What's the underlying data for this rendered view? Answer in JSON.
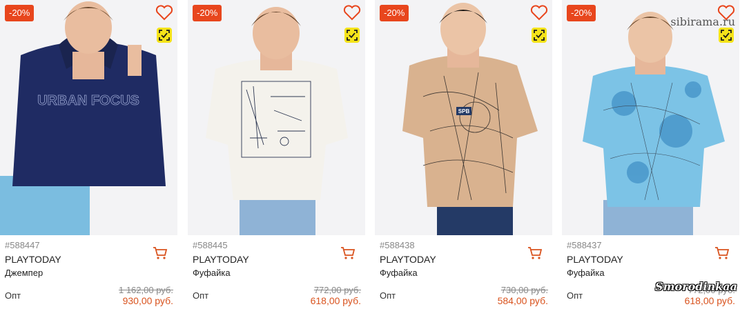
{
  "products": [
    {
      "badge": "-20%",
      "sku": "#588447",
      "brand": "PLAYTODAY",
      "type": "Джемпер",
      "opt_label": "Опт",
      "old_price": "1 162,00 руб.",
      "price": "930,00 руб.",
      "shirt_color": "#1f2b63",
      "shirt_print": "URBAN FOCUS",
      "pants_color": "#6fb6dd",
      "hoodie": true
    },
    {
      "badge": "-20%",
      "sku": "#588445",
      "brand": "PLAYTODAY",
      "type": "Фуфайка",
      "opt_label": "Опт",
      "old_price": "772,00 руб.",
      "price": "618,00 руб.",
      "shirt_color": "#f4f2ec",
      "shirt_print": "",
      "pants_color": "#8fb3d6",
      "hoodie": false
    },
    {
      "badge": "-20%",
      "sku": "#588438",
      "brand": "PLAYTODAY",
      "type": "Фуфайка",
      "opt_label": "Опт",
      "old_price": "730,00 руб.",
      "price": "584,00 руб.",
      "shirt_color": "#d9b28f",
      "shirt_print": "SPB",
      "pants_color": "#243a66",
      "hoodie": false
    },
    {
      "badge": "-20%",
      "sku": "#588437",
      "brand": "PLAYTODAY",
      "type": "Фуфайка",
      "opt_label": "Опт",
      "old_price": "772,00 руб.",
      "price": "618,00 руб.",
      "shirt_color": "#7cc3e6",
      "shirt_print": "",
      "pants_color": "#8fb3d6",
      "hoodie": false
    }
  ],
  "watermark": "sibirama.ru",
  "signature": "Smorodinkaa",
  "icons": {
    "favorite": "heart-outline-icon",
    "verified": "scan-check-icon",
    "cart": "shopping-cart-icon"
  },
  "colors": {
    "accent": "#e8461d",
    "price": "#d9531e",
    "verified_bg": "#f5e31a"
  }
}
